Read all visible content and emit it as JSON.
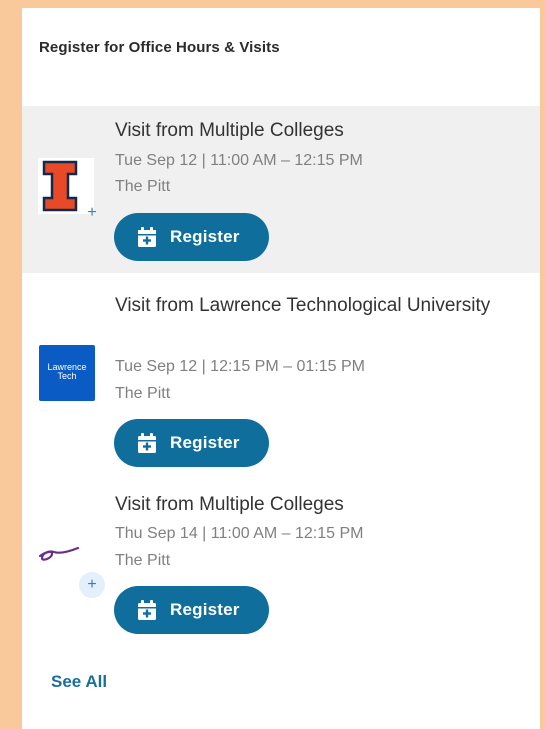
{
  "panel": {
    "title": "Register for Office Hours & Visits",
    "see_all_label": "See All"
  },
  "items": [
    {
      "title": "Visit from Multiple Colleges",
      "date": "Tue Sep 12 | 11:00 AM – 12:15 PM",
      "location": "The Pitt",
      "register_label": "Register",
      "logo": "illinois-i-logo",
      "highlighted": true
    },
    {
      "title": "Visit from Lawrence Technological University",
      "date": "Tue Sep 12 | 12:15 PM – 01:15 PM",
      "location": "The Pitt",
      "register_label": "Register",
      "logo": "lawrence-tech-logo",
      "logo_text": "Lawrence Tech"
    },
    {
      "title": "Visit from Multiple Colleges",
      "date": "Thu Sep 14 | 11:00 AM – 12:15 PM",
      "location": "The Pitt",
      "register_label": "Register",
      "logo": "script-e-logo"
    }
  ],
  "colors": {
    "accent": "#0f6e9c",
    "background": "#f9c89b",
    "highlight_row": "#f0f0f0",
    "illinois_orange": "#e84a27",
    "lawrence_blue": "#0a5bc4"
  }
}
